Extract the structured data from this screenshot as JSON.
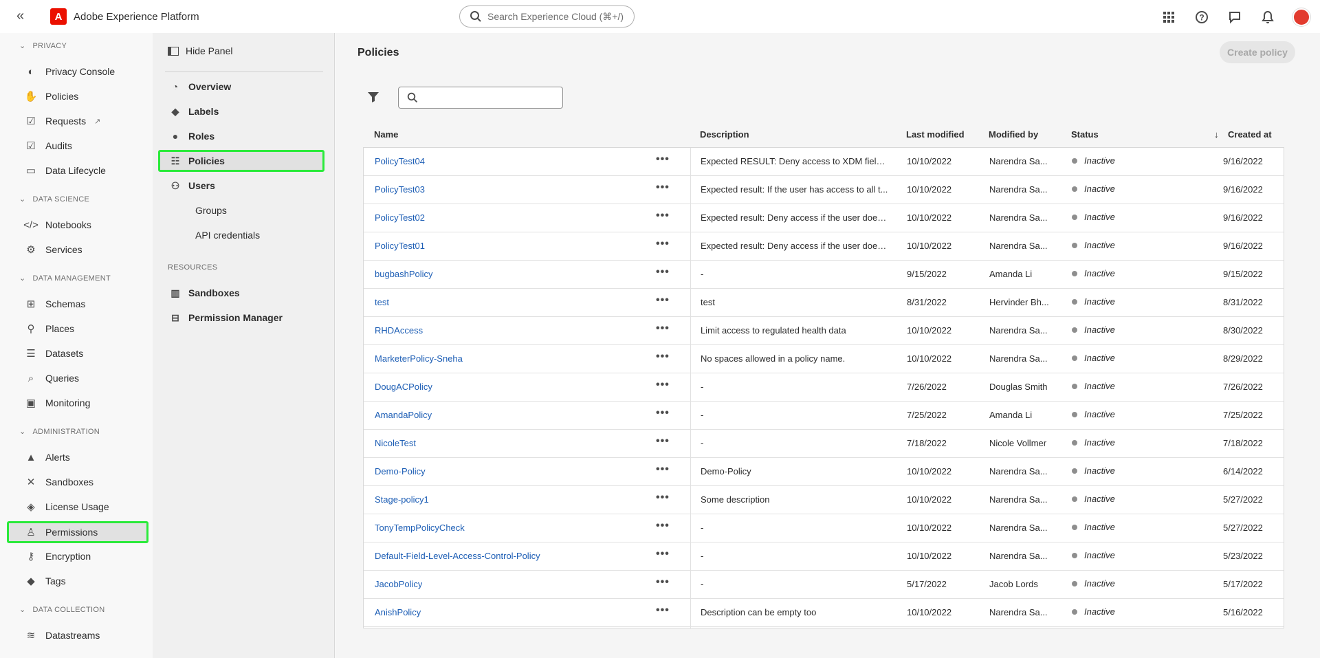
{
  "header": {
    "app_name": "Adobe Experience Platform",
    "search_placeholder": "Search Experience Cloud (⌘+/)"
  },
  "leftnav": {
    "sections": [
      {
        "title": "PRIVACY",
        "items": [
          {
            "label": "Privacy Console",
            "icon": "privacy-shield-icon"
          },
          {
            "label": "Policies",
            "icon": "hand-icon"
          },
          {
            "label": "Requests",
            "icon": "checklist-icon"
          },
          {
            "label": "Audits",
            "icon": "checklist-icon"
          },
          {
            "label": "Data Lifecycle",
            "icon": "folder-icon"
          }
        ]
      },
      {
        "title": "DATA SCIENCE",
        "items": [
          {
            "label": "Notebooks",
            "icon": "code-icon"
          },
          {
            "label": "Services",
            "icon": "gear-icon"
          }
        ]
      },
      {
        "title": "DATA MANAGEMENT",
        "items": [
          {
            "label": "Schemas",
            "icon": "schema-icon"
          },
          {
            "label": "Places",
            "icon": "pin-icon"
          },
          {
            "label": "Datasets",
            "icon": "database-icon"
          },
          {
            "label": "Queries",
            "icon": "query-icon"
          },
          {
            "label": "Monitoring",
            "icon": "monitor-icon"
          }
        ]
      },
      {
        "title": "ADMINISTRATION",
        "items": [
          {
            "label": "Alerts",
            "icon": "alert-icon"
          },
          {
            "label": "Sandboxes",
            "icon": "tools-icon"
          },
          {
            "label": "License Usage",
            "icon": "license-icon"
          },
          {
            "label": "Permissions",
            "icon": "user-lock-icon"
          },
          {
            "label": "Encryption",
            "icon": "key-icon"
          },
          {
            "label": "Tags",
            "icon": "tag-icon"
          }
        ]
      },
      {
        "title": "DATA COLLECTION",
        "items": [
          {
            "label": "Datastreams",
            "icon": "datastream-icon"
          }
        ]
      }
    ]
  },
  "subpanel": {
    "hide_label": "Hide Panel",
    "items": [
      "Overview",
      "Labels",
      "Roles",
      "Policies",
      "Users"
    ],
    "user_children": [
      "Groups",
      "API credentials"
    ],
    "resources_title": "RESOURCES",
    "resources": [
      "Sandboxes",
      "Permission Manager"
    ]
  },
  "main": {
    "title": "Policies",
    "create_label": "Create policy",
    "columns": {
      "name": "Name",
      "description": "Description",
      "last_modified": "Last modified",
      "modified_by": "Modified by",
      "status": "Status",
      "created_at": "Created at"
    },
    "rows": [
      {
        "name": "PolicyTest04",
        "description": "Expected RESULT: Deny access to XDM fields...",
        "last_modified": "10/10/2022",
        "modified_by": "Narendra Sa...",
        "status": "Inactive",
        "created_at": "9/16/2022"
      },
      {
        "name": "PolicyTest03",
        "description": "Expected result: If the user has access to all t...",
        "last_modified": "10/10/2022",
        "modified_by": "Narendra Sa...",
        "status": "Inactive",
        "created_at": "9/16/2022"
      },
      {
        "name": "PolicyTest02",
        "description": "Expected result: Deny access if the user does ...",
        "last_modified": "10/10/2022",
        "modified_by": "Narendra Sa...",
        "status": "Inactive",
        "created_at": "9/16/2022"
      },
      {
        "name": "PolicyTest01",
        "description": "Expected result: Deny access if the user does ...",
        "last_modified": "10/10/2022",
        "modified_by": "Narendra Sa...",
        "status": "Inactive",
        "created_at": "9/16/2022"
      },
      {
        "name": "bugbashPolicy",
        "description": "-",
        "last_modified": "9/15/2022",
        "modified_by": "Amanda Li",
        "status": "Inactive",
        "created_at": "9/15/2022"
      },
      {
        "name": "test",
        "description": "test",
        "last_modified": "8/31/2022",
        "modified_by": "Hervinder Bh...",
        "status": "Inactive",
        "created_at": "8/31/2022"
      },
      {
        "name": "RHDAccess",
        "description": "Limit access to regulated health data",
        "last_modified": "10/10/2022",
        "modified_by": "Narendra Sa...",
        "status": "Inactive",
        "created_at": "8/30/2022"
      },
      {
        "name": "MarketerPolicy-Sneha",
        "description": "No spaces allowed in a policy name.",
        "last_modified": "10/10/2022",
        "modified_by": "Narendra Sa...",
        "status": "Inactive",
        "created_at": "8/29/2022"
      },
      {
        "name": "DougACPolicy",
        "description": "-",
        "last_modified": "7/26/2022",
        "modified_by": "Douglas Smith",
        "status": "Inactive",
        "created_at": "7/26/2022"
      },
      {
        "name": "AmandaPolicy",
        "description": "-",
        "last_modified": "7/25/2022",
        "modified_by": "Amanda Li",
        "status": "Inactive",
        "created_at": "7/25/2022"
      },
      {
        "name": "NicoleTest",
        "description": "-",
        "last_modified": "7/18/2022",
        "modified_by": "Nicole Vollmer",
        "status": "Inactive",
        "created_at": "7/18/2022"
      },
      {
        "name": "Demo-Policy",
        "description": "Demo-Policy",
        "last_modified": "10/10/2022",
        "modified_by": "Narendra Sa...",
        "status": "Inactive",
        "created_at": "6/14/2022"
      },
      {
        "name": "Stage-policy1",
        "description": "Some description",
        "last_modified": "10/10/2022",
        "modified_by": "Narendra Sa...",
        "status": "Inactive",
        "created_at": "5/27/2022"
      },
      {
        "name": "TonyTempPolicyCheck",
        "description": "-",
        "last_modified": "10/10/2022",
        "modified_by": "Narendra Sa...",
        "status": "Inactive",
        "created_at": "5/27/2022"
      },
      {
        "name": "Default-Field-Level-Access-Control-Policy",
        "description": "-",
        "last_modified": "10/10/2022",
        "modified_by": "Narendra Sa...",
        "status": "Inactive",
        "created_at": "5/23/2022"
      },
      {
        "name": "JacobPolicy",
        "description": "-",
        "last_modified": "5/17/2022",
        "modified_by": "Jacob Lords",
        "status": "Inactive",
        "created_at": "5/17/2022"
      },
      {
        "name": "AnishPolicy",
        "description": "Description can be empty too",
        "last_modified": "10/10/2022",
        "modified_by": "Narendra Sa...",
        "status": "Inactive",
        "created_at": "5/16/2022"
      }
    ]
  },
  "colors": {
    "accent_highlight": "#2bea3b",
    "link": "#1d5eb5",
    "brand": "#eb1000"
  }
}
